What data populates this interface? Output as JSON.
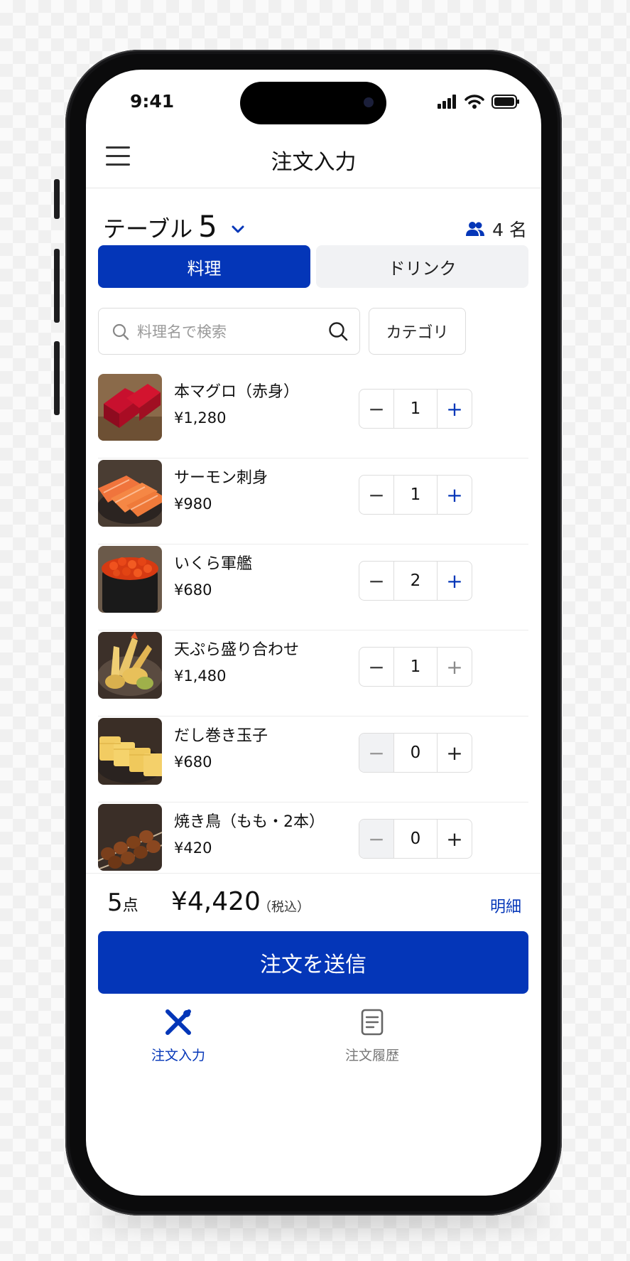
{
  "status_bar": {
    "time": "9:41"
  },
  "header": {
    "title": "注文入力",
    "menu_icon": "hamburger-icon"
  },
  "table": {
    "label": "テーブル",
    "number": "5",
    "guests": "4 名"
  },
  "tabs": [
    {
      "label": "料理",
      "active": true
    },
    {
      "label": "ドリンク",
      "active": false
    }
  ],
  "search": {
    "placeholder": "料理名で検索",
    "category_label": "カテゴリ"
  },
  "items": [
    {
      "name": "本マグロ（赤身）",
      "price": "¥1,280",
      "qty": "1"
    },
    {
      "name": "サーモン刺身",
      "price": "¥980",
      "qty": "1"
    },
    {
      "name": "いくら軍艦",
      "price": "¥680",
      "qty": "2"
    },
    {
      "name": "天ぷら盛り合わせ",
      "price": "¥1,480",
      "qty": "1"
    },
    {
      "name": "だし巻き玉子",
      "price": "¥680",
      "qty": "0"
    },
    {
      "name": "焼き鳥（もも・2本）",
      "price": "¥420",
      "qty": "0"
    }
  ],
  "summary": {
    "count": "5",
    "count_unit": "点",
    "total": "¥4,420",
    "tax_note": "（税込）",
    "detail_link": "明細"
  },
  "submit_label": "注文を送信",
  "nav": {
    "order_entry": "注文入力",
    "order_history": "注文履歴"
  },
  "colors": {
    "accent": "#0436b8",
    "disabled_bg": "#f1f2f4"
  }
}
